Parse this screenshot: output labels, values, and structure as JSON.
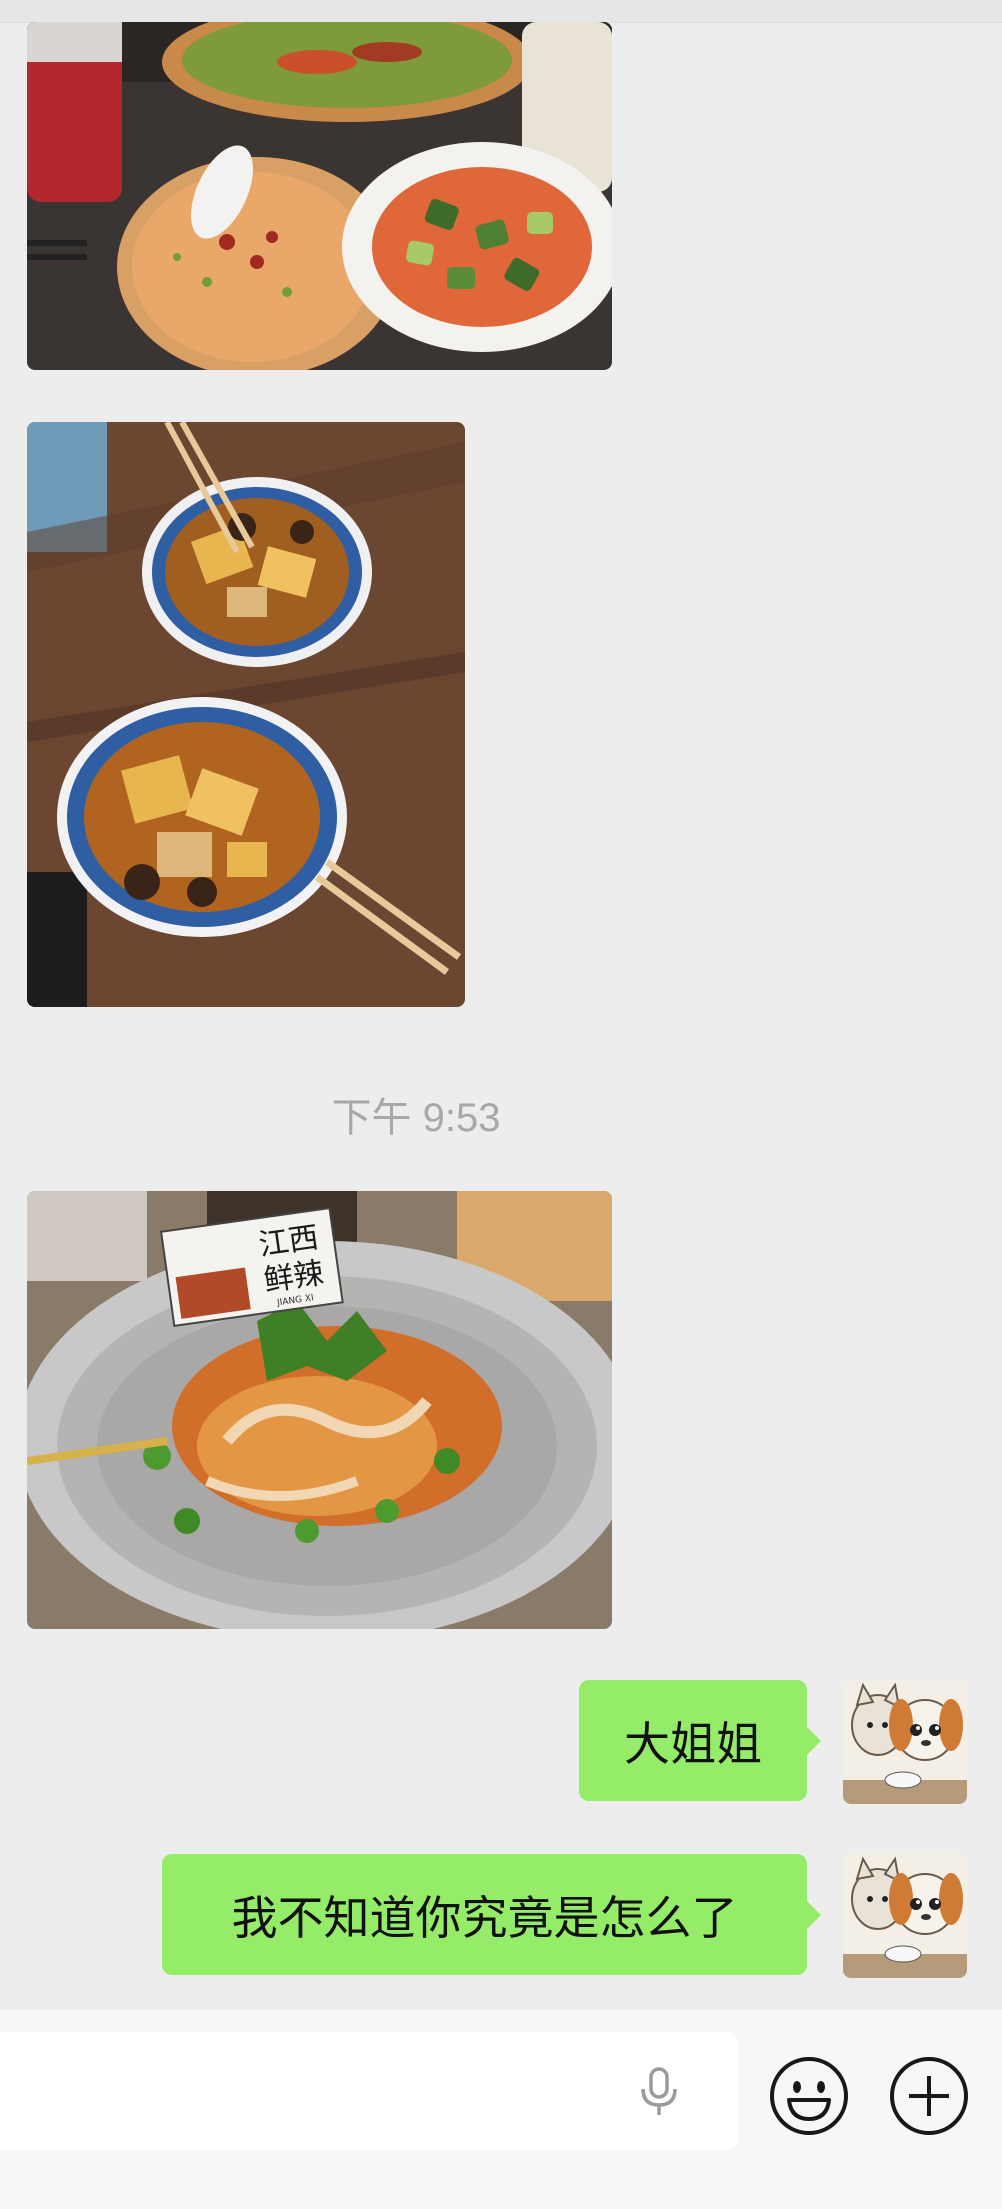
{
  "conversation": {
    "timestamp": "下午 9:53",
    "messages": [
      {
        "type": "image",
        "sender": "other",
        "subject": "spicy dishes with cucumber salad and drinks"
      },
      {
        "type": "image",
        "sender": "other",
        "subject": "two bowls of noodle soup with mushrooms and chopsticks"
      },
      {
        "type": "image",
        "sender": "other",
        "subject": "spicy squid and tofu skin platter"
      },
      {
        "type": "text",
        "sender": "me",
        "text": "大姐姐"
      },
      {
        "type": "text",
        "sender": "me",
        "text": "我不知道你究竟是怎么了"
      }
    ]
  },
  "photo3_sign": {
    "line1": "江西",
    "line2": "鲜辣",
    "line3": "JIANG XI"
  },
  "input_bar": {
    "voice_icon": "microphone-icon",
    "emoji_icon": "smiley-icon",
    "more_icon": "plus-circle-icon"
  },
  "colors": {
    "background": "#ededed",
    "bubble_green": "#95ec69",
    "timestamp_gray": "#a8a8a8",
    "input_bar": "#f7f7f7"
  }
}
